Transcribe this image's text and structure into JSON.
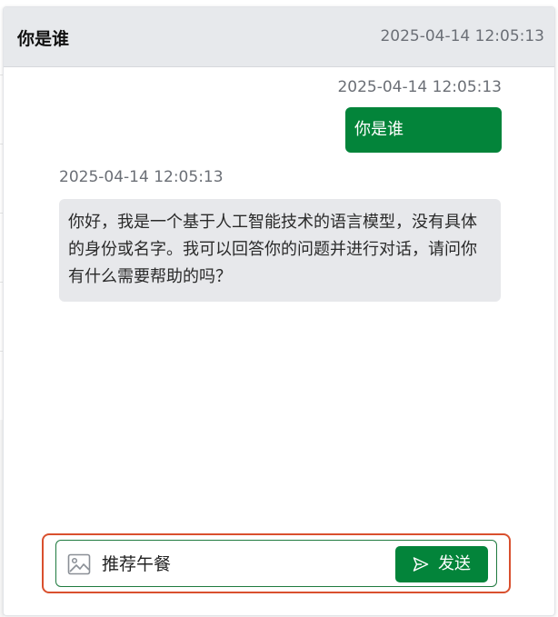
{
  "header": {
    "title": "你是谁",
    "timestamp": "2025-04-14 12:05:13"
  },
  "messages": [
    {
      "role": "user",
      "timestamp": "2025-04-14 12:05:13",
      "text": "你是谁"
    },
    {
      "role": "assistant",
      "timestamp": "2025-04-14 12:05:13",
      "text": "你好，我是一个基于人工智能技术的语言模型，没有具体的身份或名字。我可以回答你的问题并进行对话，请问你有什么需要帮助的吗？"
    }
  ],
  "composer": {
    "value": "推荐午餐",
    "send_label": "发送",
    "image_icon": "image-icon",
    "send_icon": "send-icon"
  },
  "colors": {
    "accent": "#03843a",
    "focus_outline": "#d9502e",
    "header_bg": "#e7e9ec",
    "assistant_bubble": "#e7e8eb"
  }
}
